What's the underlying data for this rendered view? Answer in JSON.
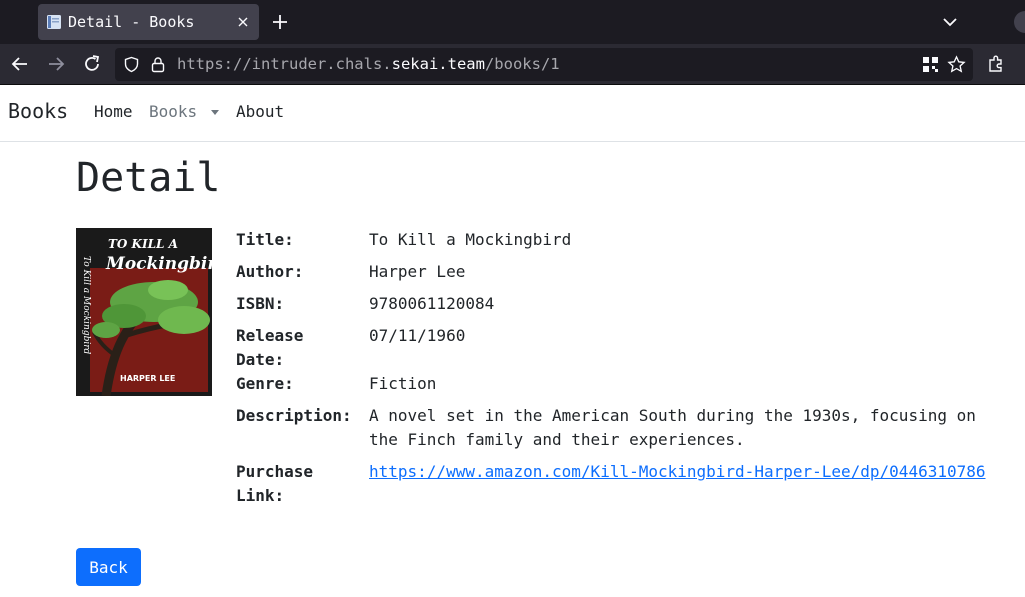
{
  "browser": {
    "tab_title": "Detail - Books",
    "url_scheme": "https://intruder.chals.",
    "url_host": "sekai.team",
    "url_path": "/books/1"
  },
  "navbar": {
    "brand": "Books",
    "items": [
      {
        "label": "Home"
      },
      {
        "label": "Books"
      },
      {
        "label": "About"
      }
    ]
  },
  "page": {
    "title": "Detail",
    "fields": [
      {
        "label": "Title:",
        "value": "To Kill a Mockingbird"
      },
      {
        "label": "Author:",
        "value": "Harper Lee"
      },
      {
        "label": "ISBN:",
        "value": "9780061120084"
      },
      {
        "label": "Release Date:",
        "value": "07/11/1960"
      },
      {
        "label": "Genre:",
        "value": "Fiction"
      },
      {
        "label": "Description:",
        "value": "A novel set in the American South during the 1930s, focusing on the Finch family and their experiences."
      },
      {
        "label": "Purchase Link:",
        "value": "https://www.amazon.com/Kill-Mockingbird-Harper-Lee/dp/0446310786"
      }
    ],
    "cover": {
      "title_line1": "TO KILL A",
      "title_line2": "Mockingbird",
      "spine_text": "To Kill a Mockingbird",
      "author": "HARPER LEE"
    },
    "back_label": "Back"
  },
  "colors": {
    "primary": "#0d6efd",
    "tabbar_bg": "#1c1b22",
    "toolbar_bg": "#2b2a33"
  }
}
